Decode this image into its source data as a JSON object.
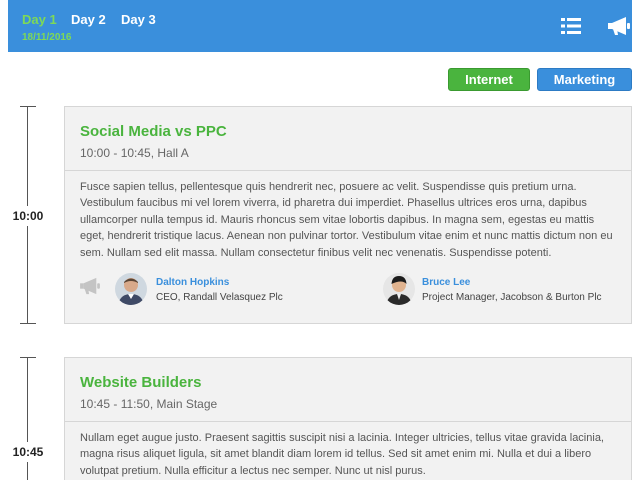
{
  "header": {
    "days": [
      {
        "label": "Day 1",
        "date": "18/11/2016"
      },
      {
        "label": "Day 2"
      },
      {
        "label": "Day 3"
      }
    ],
    "icons": {
      "list": "list-icon",
      "announce": "megaphone-icon"
    }
  },
  "filters": [
    {
      "label": "Internet",
      "color": "#4ab43e"
    },
    {
      "label": "Marketing",
      "color": "#3a8fdc"
    }
  ],
  "sessions": [
    {
      "time": "10:00",
      "title": "Social Media vs PPC",
      "subtitle": "10:00 - 10:45, Hall A",
      "description": "Fusce sapien tellus, pellentesque quis hendrerit nec, posuere ac velit. Suspendisse quis pretium urna. Vestibulum faucibus mi vel lorem viverra, id pharetra dui imperdiet. Phasellus ultrices eros urna, dapibus ullamcorper nulla tempus id. Mauris rhoncus sem vitae lobortis dapibus. In magna sem, egestas eu mattis eget, hendrerit tristique lacus. Aenean non pulvinar tortor. Vestibulum vitae enim et nunc mattis dictum non eu sem. Nullam sed elit massa. Nullam consectetur finibus velit nec venenatis. Suspendisse potenti.",
      "speakers": [
        {
          "name": "Dalton Hopkins",
          "role": "CEO, Randall Velasquez Plc"
        },
        {
          "name": "Bruce Lee",
          "role": "Project Manager, Jacobson & Burton Plc"
        }
      ]
    },
    {
      "time": "10:45",
      "title": "Website Builders",
      "subtitle": "10:45 - 11:50, Main Stage",
      "description": "Nullam eget augue justo. Praesent sagittis suscipit nisi a lacinia. Integer ultricies, tellus vitae gravida lacinia, magna risus aliquet ligula, sit amet blandit diam lorem id tellus. Sed sit amet enim mi. Nulla et dui a libero volutpat pretium. Nulla efficitur a lectus nec semper. Nunc ut nisl purus."
    }
  ],
  "colors": {
    "accent_blue": "#3a8fdc",
    "accent_green": "#4ab43e",
    "active_day": "#7ed957"
  }
}
